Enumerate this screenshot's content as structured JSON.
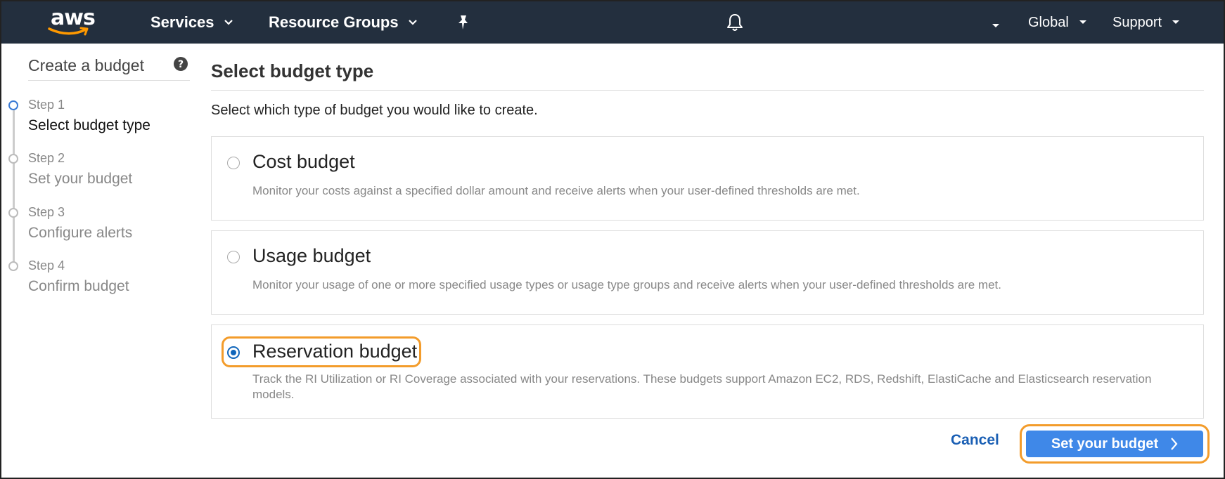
{
  "nav": {
    "logo_text": "aws",
    "services_label": "Services",
    "resource_groups_label": "Resource Groups",
    "region_label": "Global",
    "support_label": "Support"
  },
  "sidebar": {
    "title": "Create a budget",
    "steps": [
      {
        "number": "Step 1",
        "name": "Select budget type",
        "active": true
      },
      {
        "number": "Step 2",
        "name": "Set your budget",
        "active": false
      },
      {
        "number": "Step 3",
        "name": "Configure alerts",
        "active": false
      },
      {
        "number": "Step 4",
        "name": "Confirm budget",
        "active": false
      }
    ]
  },
  "main": {
    "title": "Select budget type",
    "instruction": "Select which type of budget you would like to create.",
    "options": [
      {
        "title": "Cost budget",
        "description": "Monitor your costs against a specified dollar amount and receive alerts when your user-defined thresholds are met.",
        "selected": false
      },
      {
        "title": "Usage budget",
        "description": "Monitor your usage of one or more specified usage types or usage type groups and receive alerts when your user-defined thresholds are met.",
        "selected": false
      },
      {
        "title": "Reservation budget",
        "description": "Track the RI Utilization or RI Coverage associated with your reservations. These budgets support Amazon EC2, RDS, Redshift, ElastiCache and Elasticsearch reservation models.",
        "selected": true
      }
    ],
    "cancel_label": "Cancel",
    "next_label": "Set your budget"
  },
  "colors": {
    "nav_bg": "#232f3e",
    "primary": "#3f88e8",
    "highlight": "#f39c2b",
    "link": "#1a5fb4",
    "radio_selected": "#1166bb"
  }
}
